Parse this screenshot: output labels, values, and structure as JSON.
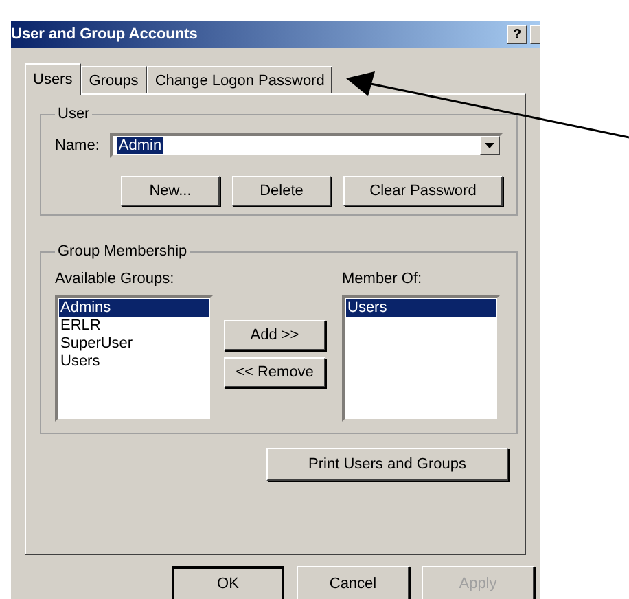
{
  "window": {
    "title": "User and Group Accounts",
    "help_button": "?"
  },
  "tabs": [
    {
      "label": "Users",
      "selected": true
    },
    {
      "label": "Groups",
      "selected": false
    },
    {
      "label": "Change Logon Password",
      "selected": false
    }
  ],
  "user_group": {
    "title": "User",
    "name_label": "Name:",
    "name_field": {
      "value": "Admin",
      "selected": true
    },
    "buttons": [
      "New...",
      "Delete",
      "Clear Password"
    ]
  },
  "group_membership": {
    "title": "Group Membership",
    "available_label": "Available Groups:",
    "available": [
      {
        "label": "Admins",
        "selected": true
      },
      {
        "label": "ERLR",
        "selected": false
      },
      {
        "label": "SuperUser",
        "selected": false
      },
      {
        "label": "Users",
        "selected": false
      }
    ],
    "add_button": "Add >>",
    "remove_button": "<< Remove",
    "member_label": "Member Of:",
    "member_of": [
      {
        "label": "Users",
        "selected": true
      }
    ]
  },
  "print_button": "Print Users and Groups",
  "dialog_buttons": [
    {
      "label": "OK",
      "default": true,
      "disabled": false
    },
    {
      "label": "Cancel",
      "default": false,
      "disabled": false
    },
    {
      "label": "Apply",
      "default": false,
      "disabled": true
    }
  ]
}
